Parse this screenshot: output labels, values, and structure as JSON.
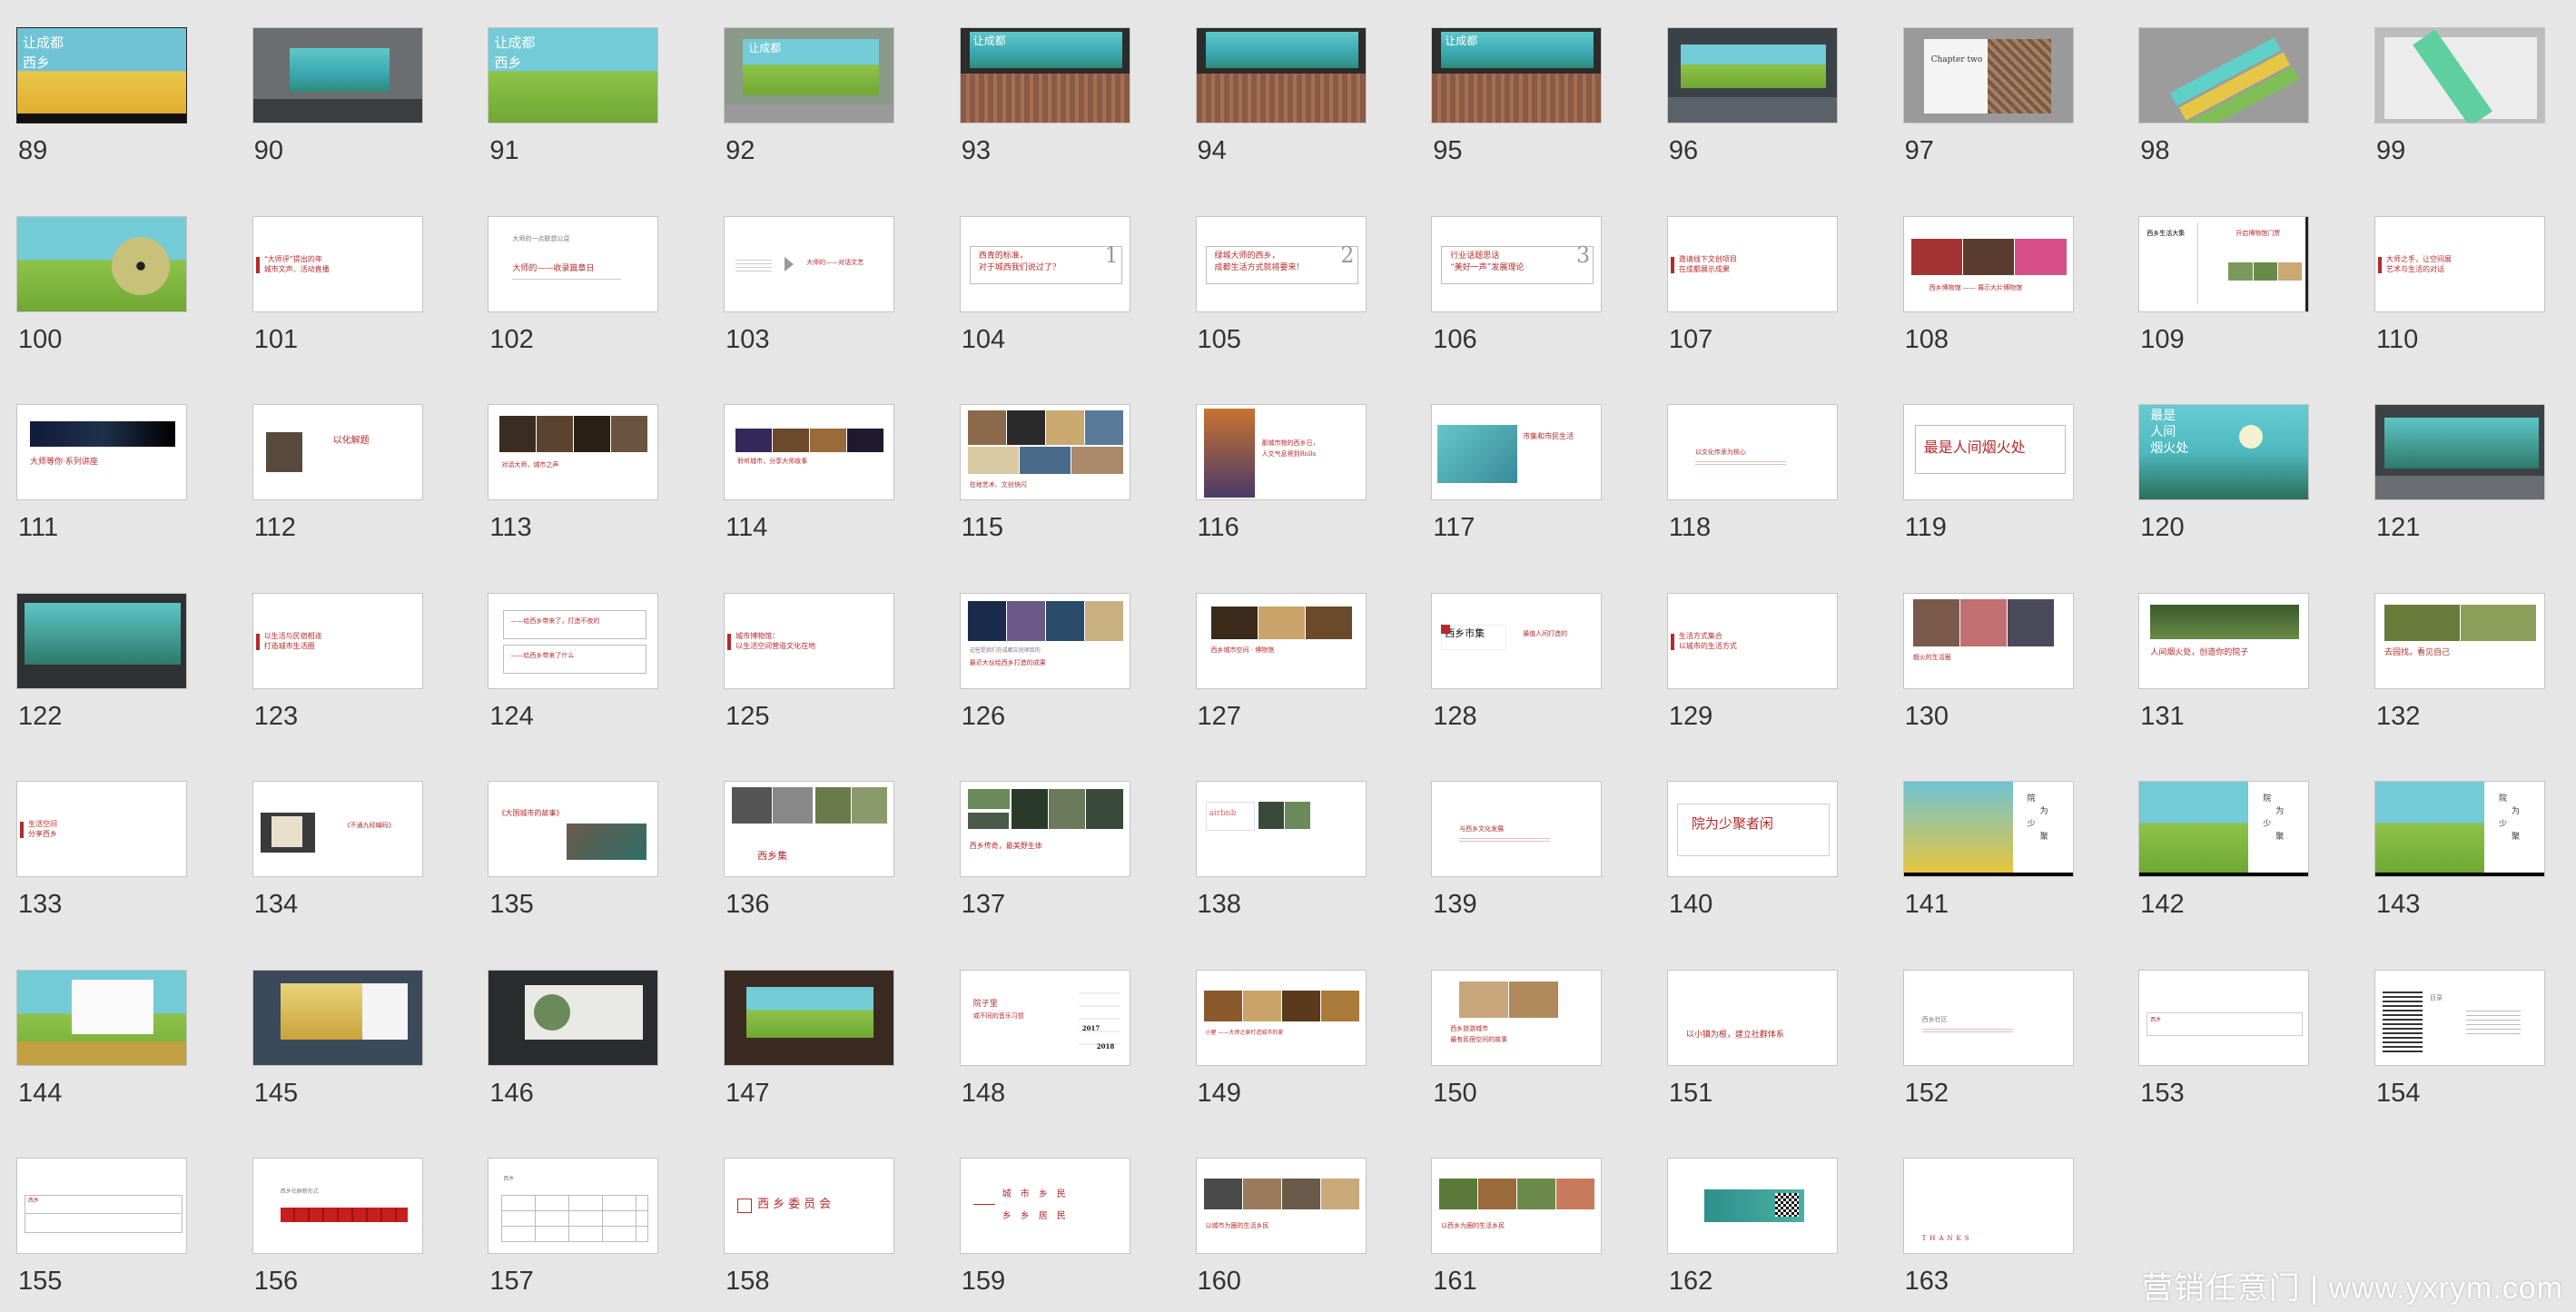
{
  "watermark": "营销任意门 | www.yxrym.com",
  "slides": [
    {
      "num": "89",
      "kind": "poster-yellow",
      "texts": [
        "让成都",
        "西乡"
      ]
    },
    {
      "num": "90",
      "kind": "billboard-teal"
    },
    {
      "num": "91",
      "kind": "poster-green",
      "texts": [
        "让成都",
        "西乡"
      ]
    },
    {
      "num": "92",
      "kind": "outdoor-green",
      "texts": [
        "让成都"
      ]
    },
    {
      "num": "93",
      "kind": "stadium-teal",
      "texts": [
        "让成都"
      ]
    },
    {
      "num": "94",
      "kind": "stadium-teal"
    },
    {
      "num": "95",
      "kind": "stadium-teal",
      "texts": [
        "让成都"
      ]
    },
    {
      "num": "96",
      "kind": "station-teal"
    },
    {
      "num": "97",
      "kind": "book",
      "texts": [
        "Chapter two"
      ]
    },
    {
      "num": "98",
      "kind": "bookmarks"
    },
    {
      "num": "99",
      "kind": "bookmark-book"
    },
    {
      "num": "100",
      "kind": "cd"
    },
    {
      "num": "101",
      "kind": "bar-text",
      "texts": [
        "“大师评”提出的年",
        "城市文声、活动直播"
      ]
    },
    {
      "num": "102",
      "kind": "title-line",
      "texts": [
        "大师的一点联想公益",
        "大师的——收录篇章日"
      ]
    },
    {
      "num": "103",
      "kind": "arrow",
      "texts": [
        "大师的——对话文艺"
      ]
    },
    {
      "num": "104",
      "kind": "boxnum",
      "texts": [
        "西青的标准，",
        "对于城西我们说过了?",
        "1"
      ]
    },
    {
      "num": "105",
      "kind": "boxnum",
      "texts": [
        "绿城大师的西乡，",
        "成都生活方式就将要来!",
        "2"
      ]
    },
    {
      "num": "106",
      "kind": "boxnum",
      "texts": [
        "行业话题思话",
        "“美好一声”发展理论",
        "3"
      ]
    },
    {
      "num": "107",
      "kind": "bar-text",
      "texts": [
        "邀请线下文创项目",
        "在成都展示成果"
      ]
    },
    {
      "num": "108",
      "kind": "photos-red",
      "texts": [
        "西乡博物馆 —— 展示大片博物馆"
      ]
    },
    {
      "num": "109",
      "kind": "tri-col",
      "texts": [
        "西乡生活大集",
        "开启博物馆门票"
      ]
    },
    {
      "num": "110",
      "kind": "bar-text",
      "texts": [
        "大师之手，让空间展",
        "艺术与生活的对话"
      ]
    },
    {
      "num": "111",
      "kind": "dark-banner",
      "texts": [
        "大师等你·系列讲座"
      ]
    },
    {
      "num": "112",
      "kind": "person",
      "texts": [
        "以化解题"
      ]
    },
    {
      "num": "113",
      "kind": "dark-banner2",
      "texts": [
        "对话大师，城市之声"
      ]
    },
    {
      "num": "114",
      "kind": "dark-banner3",
      "texts": [
        "聆听城市，分享大师故事"
      ]
    },
    {
      "num": "115",
      "kind": "collage",
      "texts": [
        "在地艺术、文创快闪"
      ]
    },
    {
      "num": "116",
      "kind": "poster-left",
      "texts": [
        "那城市物的西乡日，",
        "人文气息将到Rolls"
      ]
    },
    {
      "num": "117",
      "kind": "product",
      "texts": [
        "市集和市民生活"
      ]
    },
    {
      "num": "118",
      "kind": "small-text",
      "texts": [
        "以文化传承为核心"
      ]
    },
    {
      "num": "119",
      "kind": "box-title",
      "texts": [
        "最是人间烟火处"
      ]
    },
    {
      "num": "120",
      "kind": "teal-lotus",
      "texts": [
        "最是",
        "人间",
        "烟火处"
      ]
    },
    {
      "num": "121",
      "kind": "station-lotus"
    },
    {
      "num": "122",
      "kind": "billboard-lotus"
    },
    {
      "num": "123",
      "kind": "bar-text",
      "texts": [
        "以生活与民宿相连",
        "打造城市生活圈"
      ]
    },
    {
      "num": "124",
      "kind": "lines",
      "texts": [
        "——给西乡带来了，打造不夜的",
        "——给西乡带来了什么"
      ]
    },
    {
      "num": "125",
      "kind": "bar-text",
      "texts": [
        "城市博物馆：",
        "以生活空间营造文化在地"
      ]
    },
    {
      "num": "126",
      "kind": "photo-banner",
      "texts": [
        "这些是我们在成都文创项目的",
        "最近大伙给西乡打造的成果"
      ]
    },
    {
      "num": "127",
      "kind": "photo-banner2",
      "texts": [
        "西乡城市空间 · 博物馆"
      ]
    },
    {
      "num": "128",
      "kind": "logo-text",
      "texts": [
        "西乡市集",
        "最值人间打造的"
      ]
    },
    {
      "num": "129",
      "kind": "bar-text",
      "texts": [
        "生活方式集合",
        "以城市的生活方式"
      ]
    },
    {
      "num": "130",
      "kind": "people",
      "texts": [
        "烟火的生活圈"
      ]
    },
    {
      "num": "131",
      "kind": "garden",
      "texts": [
        "人间烟火处，创造你的院子"
      ]
    },
    {
      "num": "132",
      "kind": "garden2",
      "texts": [
        "去园找，看见自己"
      ]
    },
    {
      "num": "133",
      "kind": "bar-text",
      "texts": [
        "生活空间",
        "分享西乡"
      ]
    },
    {
      "num": "134",
      "kind": "cards",
      "texts": [
        "《不通九经编码》"
      ]
    },
    {
      "num": "135",
      "kind": "book-text",
      "texts": [
        "《大国城市的故事》"
      ]
    },
    {
      "num": "136",
      "kind": "collage2",
      "texts": [
        "西乡集"
      ]
    },
    {
      "num": "137",
      "kind": "airbnb-green",
      "texts": [
        "西乡传奇，最美野生体"
      ]
    },
    {
      "num": "138",
      "kind": "airbnb",
      "texts": [
        "airbnb"
      ]
    },
    {
      "num": "139",
      "kind": "small-text",
      "texts": [
        "与西乡文化发展"
      ]
    },
    {
      "num": "140",
      "kind": "box-title2",
      "texts": [
        "院为少聚者闲"
      ]
    },
    {
      "num": "141",
      "kind": "vert-yellow",
      "texts": [
        "院",
        "为",
        "少",
        "聚"
      ]
    },
    {
      "num": "142",
      "kind": "vert-green",
      "texts": [
        "院",
        "为",
        "少",
        "聚"
      ]
    },
    {
      "num": "143",
      "kind": "vert-green2",
      "texts": [
        "院",
        "为",
        "少",
        "聚"
      ]
    },
    {
      "num": "144",
      "kind": "billboard-vert"
    },
    {
      "num": "145",
      "kind": "night-board"
    },
    {
      "num": "146",
      "kind": "dark-board"
    },
    {
      "num": "147",
      "kind": "outdoor-board"
    },
    {
      "num": "148",
      "kind": "comic",
      "texts": [
        "院子里",
        "或不同的音乐习惯",
        "2017",
        "2018"
      ]
    },
    {
      "num": "149",
      "kind": "photo-strip",
      "texts": [
        "小屋 ——大师之家打造城市的家"
      ]
    },
    {
      "num": "150",
      "kind": "docs",
      "texts": [
        "西乡旅游城市",
        "最有民宿空间的故事"
      ]
    },
    {
      "num": "151",
      "kind": "small-red",
      "texts": [
        "以小镇为根，建立社群体系"
      ]
    },
    {
      "num": "152",
      "kind": "small-text2",
      "texts": [
        "西乡社区"
      ]
    },
    {
      "num": "153",
      "kind": "table-small",
      "texts": [
        "西乡"
      ]
    },
    {
      "num": "154",
      "kind": "list",
      "texts": [
        "目录"
      ]
    },
    {
      "num": "155",
      "kind": "table",
      "texts": [
        "西乡"
      ]
    },
    {
      "num": "156",
      "kind": "redboxes",
      "texts": [
        "西乡社群新形式"
      ]
    },
    {
      "num": "157",
      "kind": "grid-table",
      "texts": [
        "西乡"
      ]
    },
    {
      "num": "158",
      "kind": "seal-title",
      "texts": [
        "西乡委员会"
      ]
    },
    {
      "num": "159",
      "kind": "dual-title",
      "texts": [
        "城　市　乡　民",
        "乡　乡　居　民"
      ]
    },
    {
      "num": "160",
      "kind": "photo-strip2",
      "texts": [
        "以城市为圈的生活乡民"
      ]
    },
    {
      "num": "161",
      "kind": "photo-strip3",
      "texts": [
        "以西乡为圈的生活乡民"
      ]
    },
    {
      "num": "162",
      "kind": "qr"
    },
    {
      "num": "163",
      "kind": "thanks",
      "texts": [
        "THANKS"
      ]
    }
  ]
}
